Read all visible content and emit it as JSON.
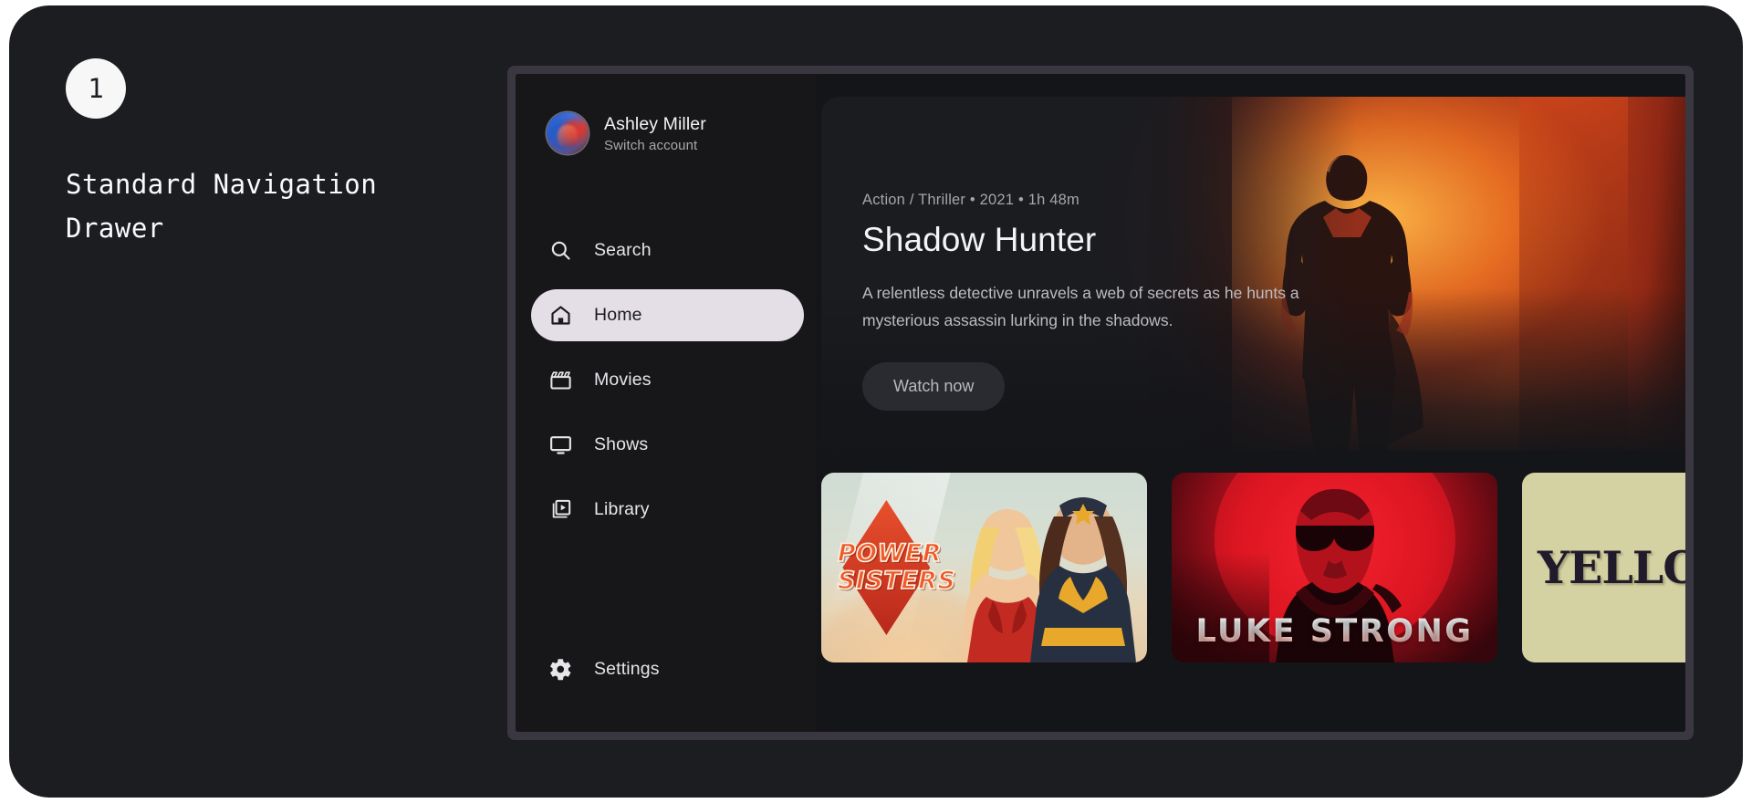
{
  "annotation": {
    "step_number": "1",
    "title": "Standard Navigation\nDrawer"
  },
  "colors": {
    "stage_bg": "#1c1d21",
    "window_frame": "#3b3741",
    "app_bg": "#141519",
    "drawer_bg": "#171719",
    "active_pill_bg": "#e4dfe7",
    "active_pill_text": "#1b1b1f",
    "text_primary": "#f2f2f4",
    "text_secondary": "#a9a8ad"
  },
  "drawer": {
    "account": {
      "name": "Ashley Miller",
      "action_label": "Switch account",
      "avatar_icon": "user-avatar"
    },
    "items": [
      {
        "id": "search",
        "label": "Search",
        "icon": "search-icon",
        "active": false
      },
      {
        "id": "home",
        "label": "Home",
        "icon": "home-icon",
        "active": true
      },
      {
        "id": "movies",
        "label": "Movies",
        "icon": "movie-icon",
        "active": false
      },
      {
        "id": "shows",
        "label": "Shows",
        "icon": "tv-icon",
        "active": false
      },
      {
        "id": "library",
        "label": "Library",
        "icon": "library-icon",
        "active": false
      }
    ],
    "bottom_items": [
      {
        "id": "settings",
        "label": "Settings",
        "icon": "gear-icon",
        "active": false
      }
    ]
  },
  "hero": {
    "meta": "Action / Thriller • 2021 • 1h 48m",
    "title": "Shadow Hunter",
    "description": "A relentless detective unravels a web of secrets as he hunts a mysterious assassin lurking in the shadows.",
    "cta_label": "Watch now",
    "artwork_alt": "hero-silhouette-orange"
  },
  "cards": [
    {
      "id": "power-sisters",
      "title_line1": "POWER",
      "title_line2": "SISTERS",
      "artwork_alt": "two-heroines-poster"
    },
    {
      "id": "luke-strong",
      "title": "LUKE STRONG",
      "artwork_alt": "man-in-sunglasses-red-poster"
    },
    {
      "id": "yellow",
      "title": "YELLOW",
      "artwork_alt": "yellow-serif-poster"
    }
  ]
}
